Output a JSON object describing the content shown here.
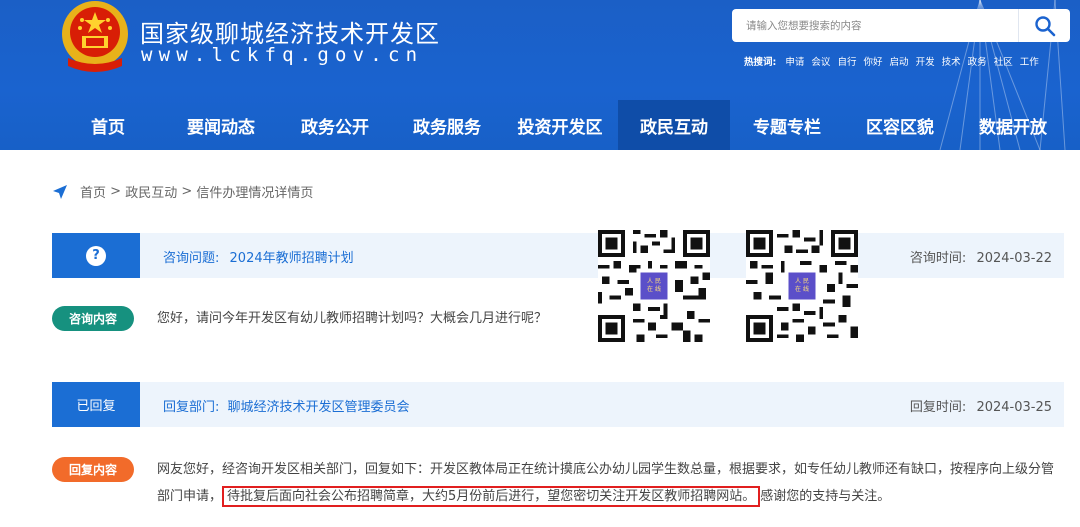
{
  "header": {
    "site_title": "国家级聊城经济技术开发区",
    "site_url": "www.lckfq.gov.cn",
    "search_placeholder": "请输入您想要搜索的内容",
    "hot_label": "热搜词:",
    "hot_keywords": [
      "申请",
      "会议",
      "自行",
      "你好",
      "启动",
      "开发",
      "技术",
      "政务",
      "社区",
      "工作"
    ]
  },
  "nav": {
    "items": [
      {
        "label": "首页"
      },
      {
        "label": "要闻动态"
      },
      {
        "label": "政务公开"
      },
      {
        "label": "政务服务"
      },
      {
        "label": "投资开发区"
      },
      {
        "label": "政民互动",
        "active": true
      },
      {
        "label": "专题专栏"
      },
      {
        "label": "区容区貌"
      },
      {
        "label": "数据开放"
      }
    ]
  },
  "breadcrumb": {
    "home": "首页",
    "sep1": " > ",
    "section": "政民互动",
    "sep2": " > ",
    "current": "信件办理情况详情页"
  },
  "question": {
    "icon_glyph": "?",
    "title_label": "咨询问题:",
    "title_value": "2024年教师招聘计划",
    "time_label": "咨询时间:",
    "time_value": "2024-03-22",
    "content_pill": "咨询内容",
    "content_text": "您好，请问今年开发区有幼儿教师招聘计划吗？大概会几月进行呢？"
  },
  "reply": {
    "status": "已回复",
    "dept_label": "回复部门:",
    "dept_value": "聊城经济技术开发区管理委员会",
    "time_label": "回复时间:",
    "time_value": "2024-03-25",
    "content_pill": "回复内容",
    "text_part1": "网友您好，经咨询开发区相关部门，回复如下：开发区教体局正在统计摸底公办幼儿园学生数总量，根据要求，如专任幼儿教师还有缺口，按程序向上",
    "text_part2": "级分管部门申请，",
    "text_highlight": "待批复后面向社会公布招聘简章，大约5月份前后进行，望您密切关注开发区教师招聘网站。",
    "text_part3": "感谢您的支持与关注。"
  },
  "qr_codes": {
    "badge_text": "人 民\n在 线"
  },
  "colors": {
    "header_blue": "#1b63cf",
    "nav_active": "#0f4da8",
    "accent_blue": "#1b6ed4",
    "pill_teal": "#16917f",
    "pill_orange": "#f26b2a",
    "highlight_red": "#e11f1f"
  }
}
